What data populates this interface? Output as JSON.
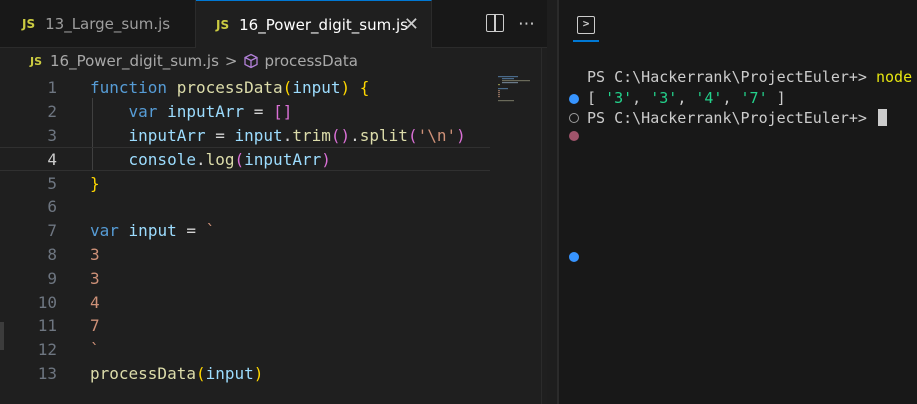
{
  "tabs": [
    {
      "badge": "JS",
      "label": "13_Large_sum.js",
      "active": false
    },
    {
      "badge": "JS",
      "label": "16_Power_digit_sum.js",
      "active": true,
      "close": "✕"
    }
  ],
  "breadcrumb": {
    "badge": "JS",
    "file": "16_Power_digit_sum.js",
    "separator": ">",
    "symbol": "processData"
  },
  "line_numbers": [
    "1",
    "2",
    "3",
    "4",
    "5",
    "6",
    "7",
    "8",
    "9",
    "10",
    "11",
    "12",
    "13"
  ],
  "active_line": 4,
  "code": {
    "l1": {
      "kw": "function",
      "fn": "processData",
      "paren_open": "(",
      "param": "input",
      "paren_close": ")",
      "brace": "{"
    },
    "l2": {
      "kw": "var",
      "name": "inputArr",
      "eq": "=",
      "arr": "[]"
    },
    "l3": {
      "name": "inputArr",
      "eq": "=",
      "obj": "input",
      "dot1": ".",
      "m1": "trim",
      "call1": "()",
      "dot2": ".",
      "m2": "split",
      "p_open": "(",
      "arg": "'\\n'",
      "p_close": ")"
    },
    "l4": {
      "obj": "console",
      "dot": ".",
      "m": "log",
      "p_open": "(",
      "arg": "inputArr",
      "p_close": ")"
    },
    "l5": {
      "brace": "}"
    },
    "l7": {
      "kw": "var",
      "name": "input",
      "eq": "=",
      "tick": "`"
    },
    "l8": "3",
    "l9": "3",
    "l10": "4",
    "l11": "7",
    "l12": "`",
    "l13": {
      "fn": "processData",
      "p_open": "(",
      "arg": "input",
      "p_close": ")"
    }
  },
  "terminal": {
    "prompt1": "PS C:\\Hackerrank\\ProjectEuler+>",
    "cmd1": "node",
    "output": {
      "open": "[",
      "v1": "'3'",
      "v2": "'3'",
      "v3": "'4'",
      "v4": "'7'",
      "close": "]",
      "sep": ","
    },
    "prompt2": "PS C:\\Hackerrank\\ProjectEuler+>"
  },
  "colors": {
    "accent": "#0078d4",
    "js_badge": "#cbcb41",
    "string": "#ce9178",
    "keyword": "#569cd6"
  }
}
